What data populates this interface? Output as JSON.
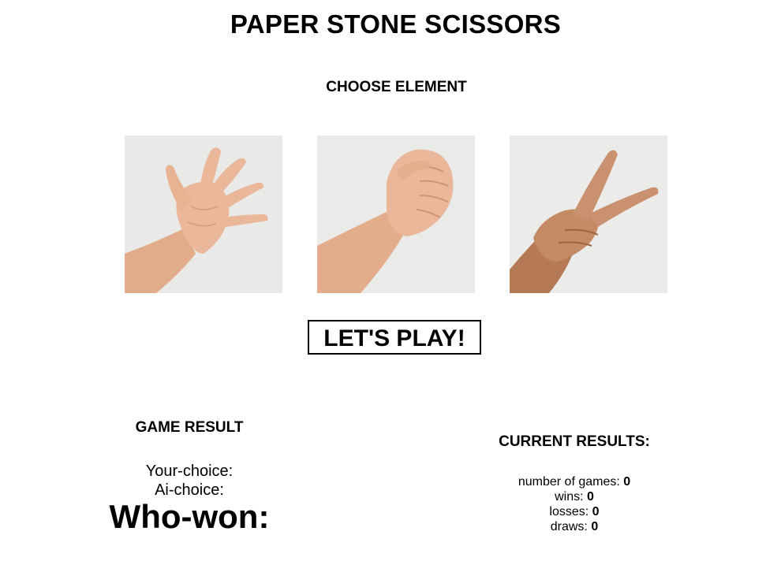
{
  "header": {
    "title": "PAPER STONE SCISSORS",
    "subtitle": "CHOOSE ELEMENT"
  },
  "choices": [
    {
      "id": "paper",
      "icon": "open-hand-image"
    },
    {
      "id": "stone",
      "icon": "fist-image"
    },
    {
      "id": "scissors",
      "icon": "victory-hand-image"
    }
  ],
  "play_button": {
    "label": "LET'S PLAY!"
  },
  "game_result": {
    "heading": "GAME RESULT",
    "your_choice_label": "Your-choice:",
    "ai_choice_label": "Ai-choice:",
    "who_won_label": "Who-won:"
  },
  "current_results": {
    "heading": "CURRENT RESULTS:",
    "games_label": "number of games:",
    "games_value": "0",
    "wins_label": "wins:",
    "wins_value": "0",
    "losses_label": "losses:",
    "losses_value": "0",
    "draws_label": "draws:",
    "draws_value": "0"
  },
  "colors": {
    "background": "#ffffff",
    "text": "#000000",
    "photo_background": "#e8e8e6",
    "skin": "#e8b99a"
  }
}
